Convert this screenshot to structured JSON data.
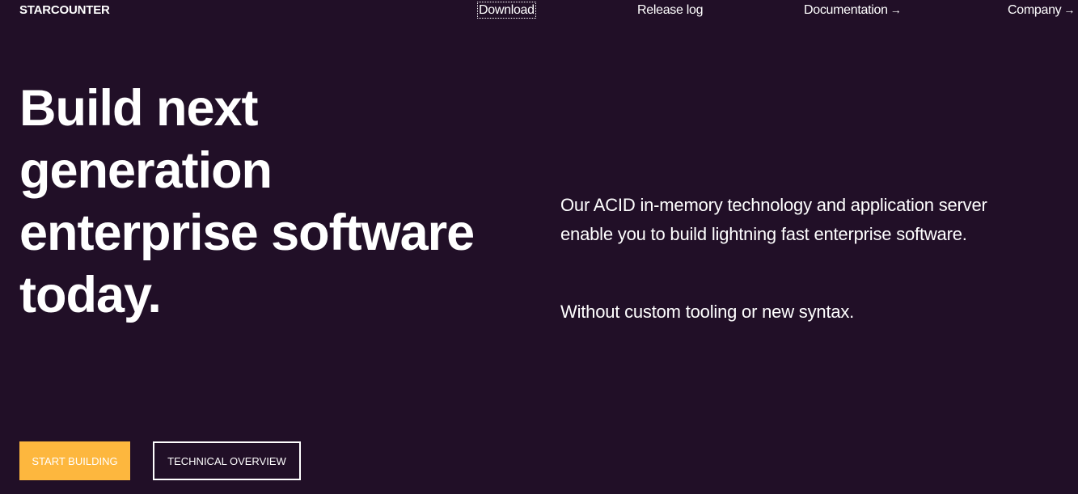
{
  "brand": {
    "name": "STARCOUNTER"
  },
  "nav": {
    "items": [
      {
        "label": "Download",
        "arrow": ""
      },
      {
        "label": "Release log",
        "arrow": ""
      },
      {
        "label": "Documentation",
        "arrow": "→"
      },
      {
        "label": "Company",
        "arrow": "→"
      }
    ]
  },
  "hero": {
    "headline_lines": [
      "Build next",
      "generation",
      "enterprise software",
      "today."
    ],
    "lead": "Our ACID in-memory technology and application server enable you to build lightning fast enterprise software.",
    "sub": "Without custom tooling or new syntax."
  },
  "cta": {
    "primary_label": "START BUILDING",
    "secondary_label": "TECHNICAL OVERVIEW"
  },
  "colors": {
    "background": "#210f27",
    "accent": "#fdb73e",
    "text": "#ffffff"
  }
}
